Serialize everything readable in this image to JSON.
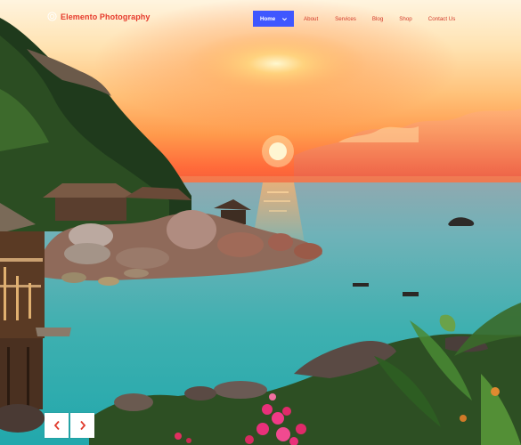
{
  "site": {
    "name": "Elemento Photography",
    "logo_icon": "sun-circle-icon"
  },
  "nav": {
    "items": [
      {
        "label": "Home",
        "active": true,
        "has_dropdown": true
      },
      {
        "label": "About"
      },
      {
        "label": "Services"
      },
      {
        "label": "Blog"
      },
      {
        "label": "Shop"
      },
      {
        "label": "Contact Us"
      }
    ]
  },
  "slider": {
    "prev_icon": "chevron-left-icon",
    "next_icon": "chevron-right-icon"
  },
  "colors": {
    "brand": "#e63a2c",
    "nav_active_bg": "#3f57ff",
    "nav_link": "#d23a2a",
    "arrow": "#e03a2c"
  }
}
